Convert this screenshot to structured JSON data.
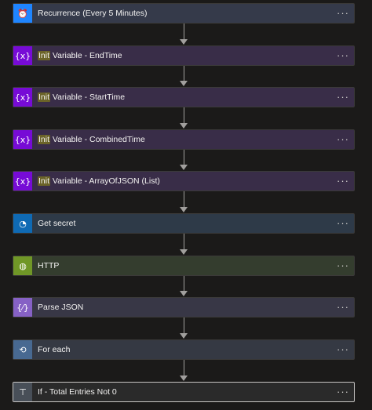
{
  "steps": [
    {
      "label": "Recurrence (Every 5 Minutes)",
      "icon": "alarm-clock-icon",
      "glyph": "⏰",
      "bg": "#353a4a",
      "iconbg": "#1f85ff",
      "init": "",
      "rest": ""
    },
    {
      "label": "",
      "icon": "variable-icon",
      "glyph": "{x}",
      "bg": "#392d48",
      "iconbg": "#770bd6",
      "init": "Init",
      "rest": " Variable - EndTime"
    },
    {
      "label": "",
      "icon": "variable-icon",
      "glyph": "{x}",
      "bg": "#392d48",
      "iconbg": "#770bd6",
      "init": "Init",
      "rest": " Variable - StartTime"
    },
    {
      "label": "",
      "icon": "variable-icon",
      "glyph": "{x}",
      "bg": "#392d48",
      "iconbg": "#770bd6",
      "init": "Init",
      "rest": " Variable - CombinedTime"
    },
    {
      "label": "",
      "icon": "variable-icon",
      "glyph": "{x}",
      "bg": "#392d48",
      "iconbg": "#770bd6",
      "init": "Init",
      "rest": " Variable - ArrayOfJSON (List)"
    },
    {
      "label": "Get secret",
      "icon": "key-vault-icon",
      "glyph": "◔",
      "bg": "#2e3a48",
      "iconbg": "#0f6ab4",
      "init": "",
      "rest": ""
    },
    {
      "label": "HTTP",
      "icon": "globe-icon",
      "glyph": "◍",
      "bg": "#343d2e",
      "iconbg": "#709727",
      "init": "",
      "rest": ""
    },
    {
      "label": "Parse JSON",
      "icon": "json-icon",
      "glyph": "{⁄}",
      "bg": "#383746",
      "iconbg": "#8661c5",
      "init": "",
      "rest": ""
    },
    {
      "label": "For each",
      "icon": "loop-icon",
      "glyph": "⟲",
      "bg": "#353943",
      "iconbg": "#486991",
      "init": "",
      "rest": ""
    },
    {
      "label": "If - Total Entries Not 0",
      "icon": "condition-icon",
      "glyph": "⊤",
      "bg": "#2a2a2a",
      "iconbg": "#484f58",
      "init": "",
      "rest": ""
    }
  ],
  "more_glyph": "···"
}
